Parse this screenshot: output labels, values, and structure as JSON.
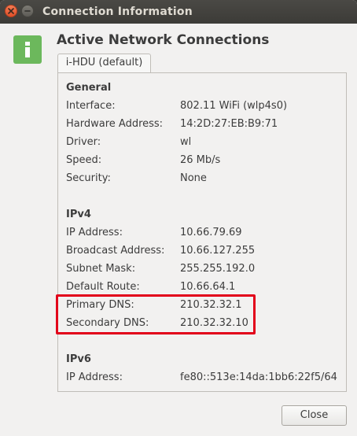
{
  "window": {
    "title": "Connection Information"
  },
  "heading": "Active Network Connections",
  "tab": "i-HDU (default)",
  "general": {
    "title": "General",
    "rows": [
      {
        "label": "Interface:",
        "value": "802.11 WiFi (wlp4s0)"
      },
      {
        "label": "Hardware Address:",
        "value": "14:2D:27:EB:B9:71"
      },
      {
        "label": "Driver:",
        "value": "wl"
      },
      {
        "label": "Speed:",
        "value": "26 Mb/s"
      },
      {
        "label": "Security:",
        "value": "None"
      }
    ]
  },
  "ipv4": {
    "title": "IPv4",
    "rows": [
      {
        "label": "IP Address:",
        "value": "10.66.79.69"
      },
      {
        "label": "Broadcast Address:",
        "value": "10.66.127.255"
      },
      {
        "label": "Subnet Mask:",
        "value": "255.255.192.0"
      },
      {
        "label": "Default Route:",
        "value": "10.66.64.1"
      },
      {
        "label": "Primary DNS:",
        "value": "210.32.32.1"
      },
      {
        "label": "Secondary DNS:",
        "value": "210.32.32.10"
      }
    ]
  },
  "ipv6": {
    "title": "IPv6",
    "rows": [
      {
        "label": "IP Address:",
        "value": "fe80::513e:14da:1bb6:22f5/64"
      }
    ]
  },
  "buttons": {
    "close": "Close"
  },
  "colors": {
    "highlight": "#e2001a",
    "info_icon": "#6cb85c"
  }
}
